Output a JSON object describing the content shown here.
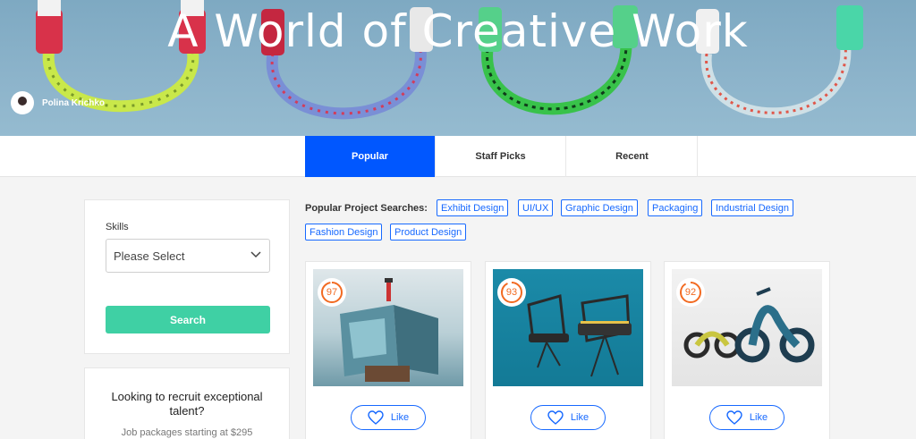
{
  "hero": {
    "title": "A World of Creative Work",
    "credit_name": "Polina Krichko"
  },
  "tabs": [
    {
      "label": "Popular",
      "active": true
    },
    {
      "label": "Staff Picks",
      "active": false
    },
    {
      "label": "Recent",
      "active": false
    }
  ],
  "filter": {
    "skills_label": "Skills",
    "select_value": "Please Select",
    "search_label": "Search"
  },
  "recruit": {
    "title": "Looking to recruit exceptional talent?",
    "subtitle": "Job packages starting at $295"
  },
  "popular_searches": {
    "label": "Popular Project Searches:",
    "chips": [
      "Exhibit Design",
      "UI/UX",
      "Graphic Design",
      "Packaging",
      "Industrial Design",
      "Fashion Design",
      "Product Design"
    ]
  },
  "projects": [
    {
      "score": "97",
      "like_label": "Like"
    },
    {
      "score": "93",
      "like_label": "Like"
    },
    {
      "score": "92",
      "like_label": "Like"
    }
  ],
  "colors": {
    "accent_blue": "#0057ff",
    "chip_blue": "#1769ff",
    "search_green": "#3fd0a4",
    "badge_orange": "#f26a21"
  },
  "icons": [
    "user-avatar",
    "chevron-down-icon",
    "heart-icon",
    "score-ring-icon"
  ]
}
